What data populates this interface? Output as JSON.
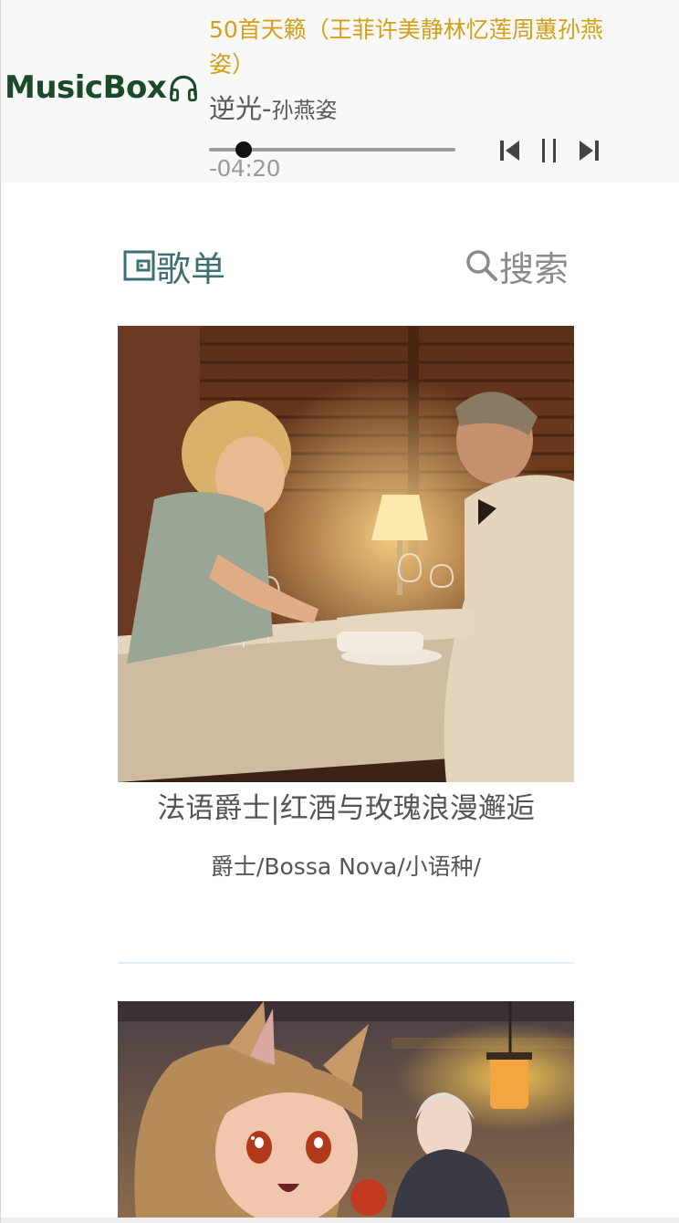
{
  "app": {
    "name": "MusicBox",
    "logo_icon": "headphones-icon"
  },
  "player": {
    "playlist_title": "50首天籁（王菲许美静林忆莲周蕙孙燕姿）",
    "song_title": "逆光",
    "separator": "-",
    "artist": "孙燕姿",
    "remaining_time": "-04:20",
    "progress_fraction": 0.14,
    "controls": [
      "previous-icon",
      "pause-icon",
      "next-icon"
    ]
  },
  "tabs": [
    {
      "label": "歌单",
      "icon": "playlist-icon",
      "active": true
    },
    {
      "label": "搜索",
      "icon": "search-icon",
      "active": false
    }
  ],
  "playlists": [
    {
      "title": "法语爵士|红酒与玫瑰浪漫邂逅",
      "tags": "爵士/Bossa Nova/小语种/"
    },
    {
      "title": "",
      "tags": ""
    }
  ],
  "colors": {
    "logo": "#1b4a2a",
    "playlist_title": "#d4a017",
    "active_tab": "#3f6f73",
    "inactive_tab": "#8a8a8a",
    "header_bg": "#f8f8f8"
  }
}
